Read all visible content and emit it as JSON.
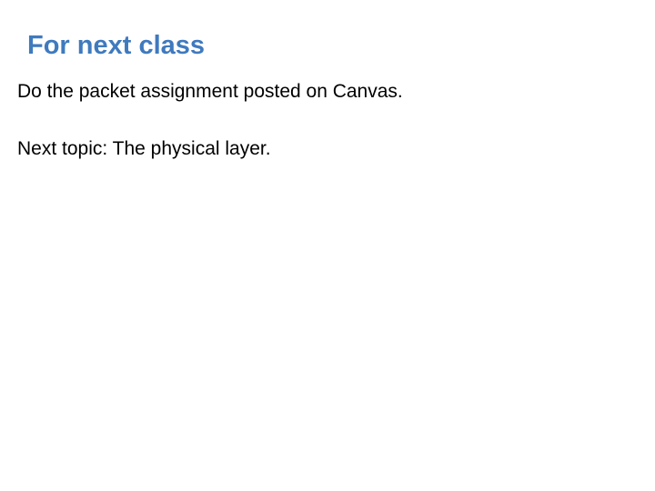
{
  "slide": {
    "title": "For next class",
    "title_color": "#3f7abe",
    "lines": [
      "Do the packet assignment posted on Canvas.",
      "Next topic: The physical layer."
    ]
  }
}
